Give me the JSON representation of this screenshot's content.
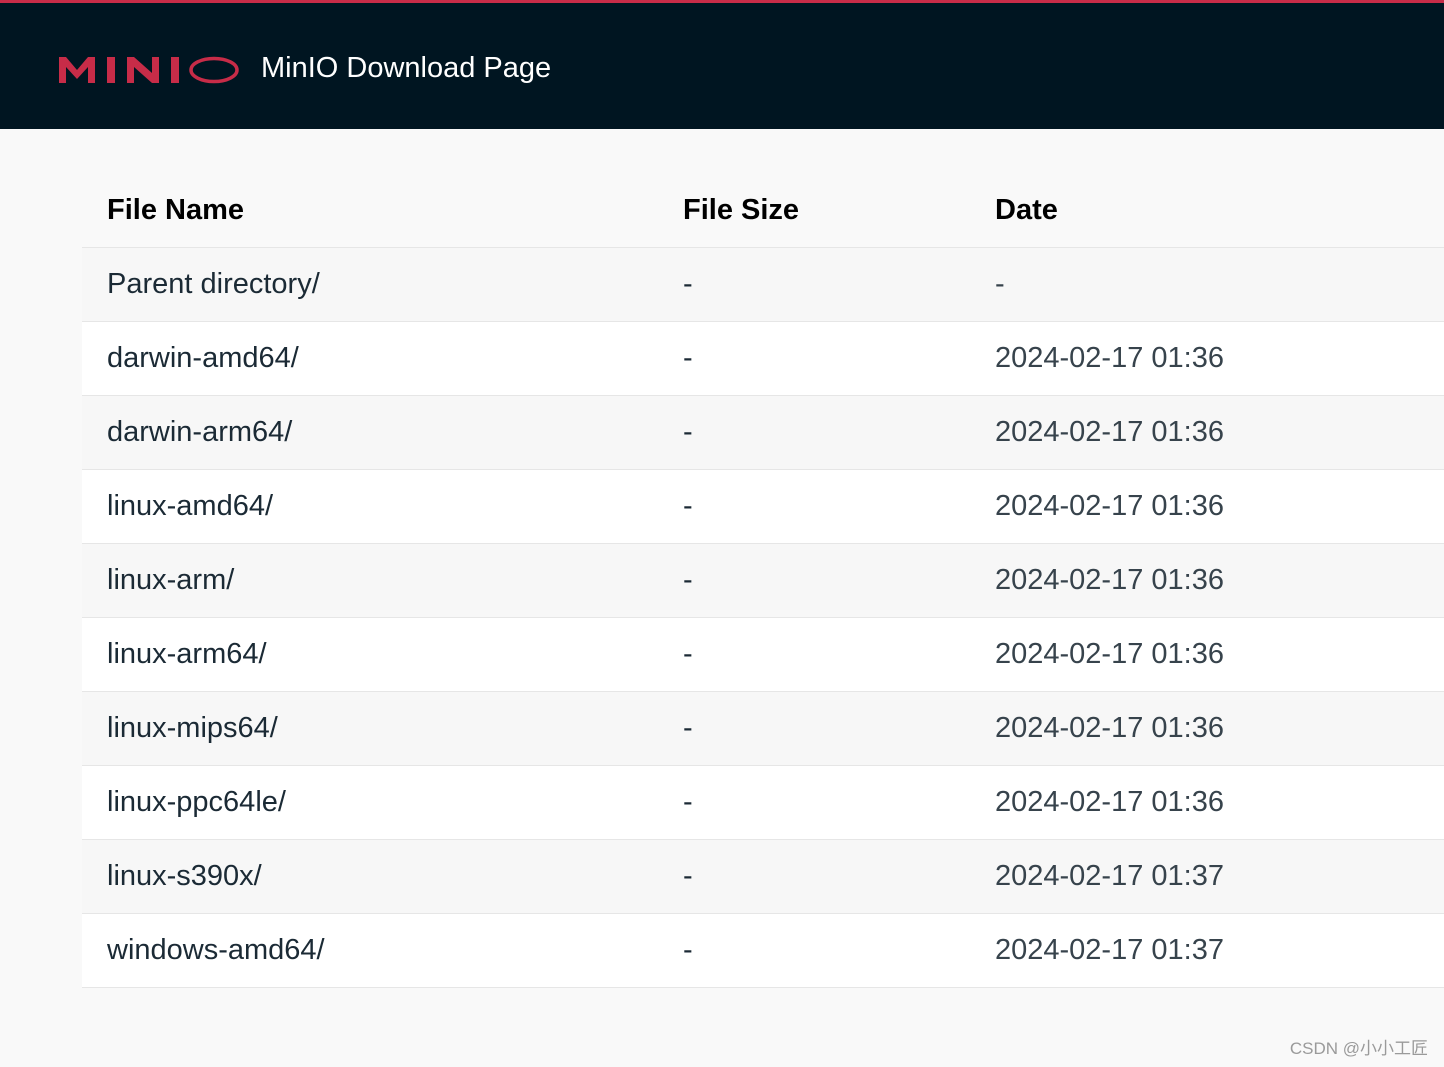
{
  "header": {
    "logo_text": "MINIO",
    "title": "MinIO Download Page"
  },
  "colors": {
    "header_bg": "#001521",
    "brand_accent": "#c72c48"
  },
  "table": {
    "columns": [
      "File Name",
      "File Size",
      "Date"
    ],
    "rows": [
      {
        "name": "Parent directory/",
        "size": "-",
        "date": "-"
      },
      {
        "name": "darwin-amd64/",
        "size": "-",
        "date": "2024-02-17 01:36"
      },
      {
        "name": "darwin-arm64/",
        "size": "-",
        "date": "2024-02-17 01:36"
      },
      {
        "name": "linux-amd64/",
        "size": "-",
        "date": "2024-02-17 01:36"
      },
      {
        "name": "linux-arm/",
        "size": "-",
        "date": "2024-02-17 01:36"
      },
      {
        "name": "linux-arm64/",
        "size": "-",
        "date": "2024-02-17 01:36"
      },
      {
        "name": "linux-mips64/",
        "size": "-",
        "date": "2024-02-17 01:36"
      },
      {
        "name": "linux-ppc64le/",
        "size": "-",
        "date": "2024-02-17 01:36"
      },
      {
        "name": "linux-s390x/",
        "size": "-",
        "date": "2024-02-17 01:37"
      },
      {
        "name": "windows-amd64/",
        "size": "-",
        "date": "2024-02-17 01:37"
      }
    ]
  },
  "watermark": "CSDN @小小工匠"
}
